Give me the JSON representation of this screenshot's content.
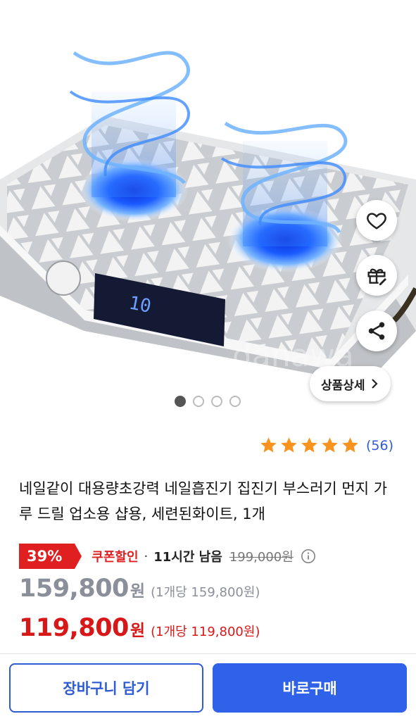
{
  "product_image": {
    "alt": "네일흡진기 제품 이미지",
    "display_digits": "10",
    "watermark": "danawa"
  },
  "actions": {
    "wish_icon": "heart-icon",
    "gift_icon": "gift-icon",
    "share_icon": "share-icon",
    "detail_label": "상품상세",
    "detail_icon": "chevron-right-icon"
  },
  "carousel": {
    "total": 4,
    "active_index": 0
  },
  "rating": {
    "stars": 5,
    "review_count": "(56)",
    "star_color": "#f7931e"
  },
  "product": {
    "title": "네일같이 대용량초강력 네일흡진기 집진기 부스러기 먼지 가루 드릴 업소용 샵용, 세련된화이트, 1개"
  },
  "pricing": {
    "discount_badge": "39%",
    "coupon_label": "쿠폰할인",
    "separator": "·",
    "time_left": "11시간 남음",
    "original_price": "199,000원",
    "sale_price": "159,800",
    "sale_currency": "원",
    "sale_unit_price": "(1개당 159,800원)",
    "coupon_price": "119,800",
    "coupon_currency": "원",
    "coupon_unit_price": "(1개당 119,800원)",
    "accent_red": "#e02020",
    "accent_blue": "#2f62e8"
  },
  "bottom_bar": {
    "cart_label": "장바구니 담기",
    "buy_label": "바로구매"
  }
}
